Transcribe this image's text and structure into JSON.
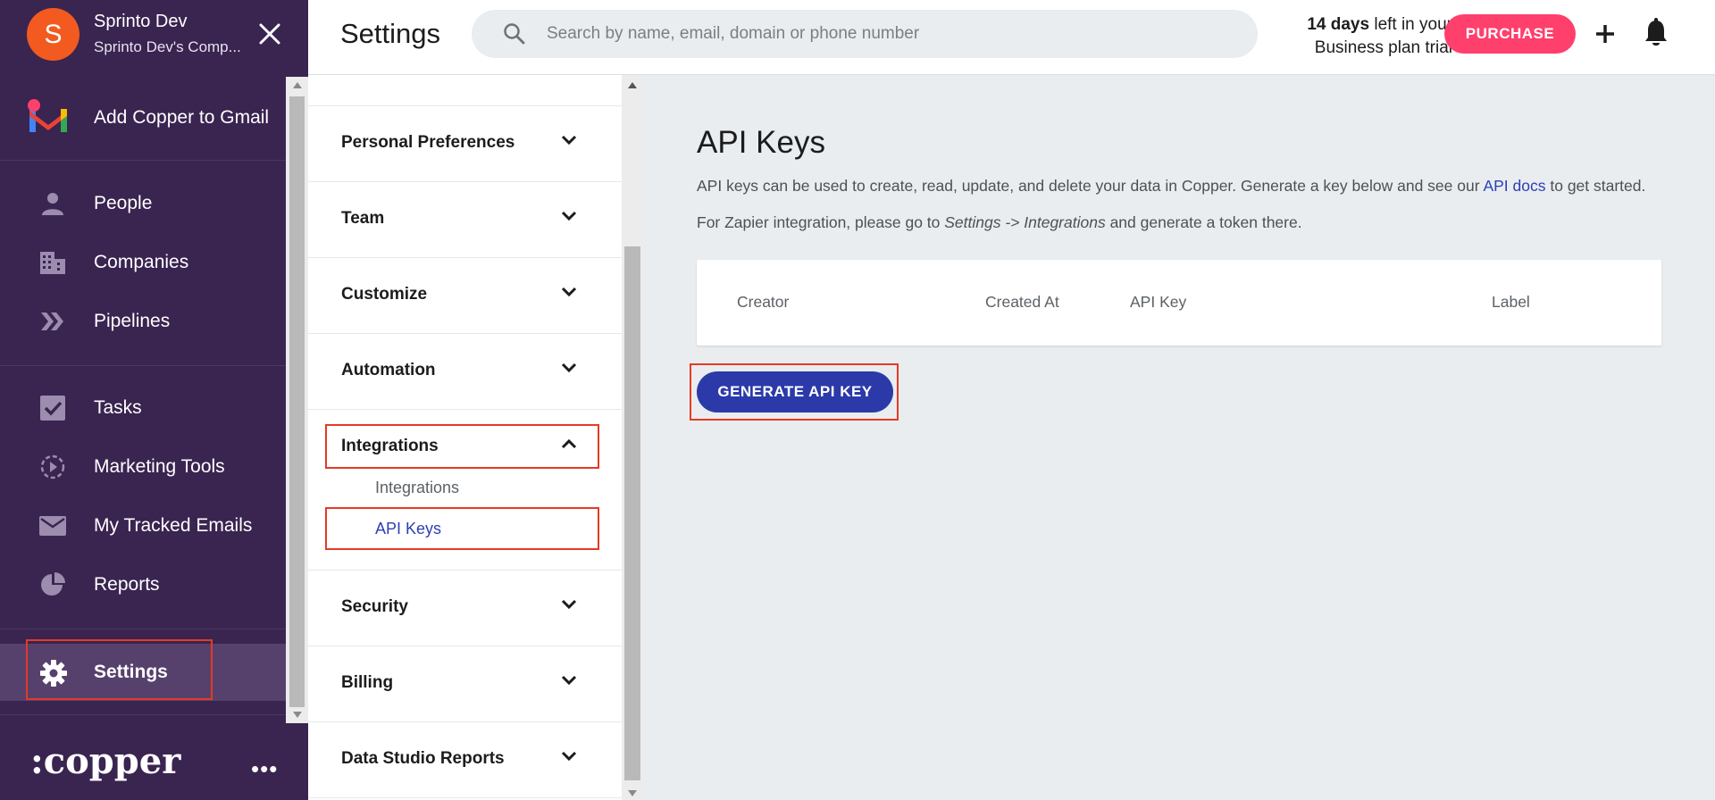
{
  "sidebar": {
    "user": {
      "initial": "S",
      "name": "Sprinto Dev",
      "company": "Sprinto Dev's Comp..."
    },
    "gmail_label": "Add Copper to Gmail",
    "nav_primary": [
      {
        "label": "People",
        "icon": "person-icon"
      },
      {
        "label": "Companies",
        "icon": "building-icon"
      },
      {
        "label": "Pipelines",
        "icon": "chevrons-right-icon"
      }
    ],
    "nav_secondary": [
      {
        "label": "Tasks",
        "icon": "checkbox-icon"
      },
      {
        "label": "Marketing Tools",
        "icon": "marketing-play-icon"
      },
      {
        "label": "My Tracked Emails",
        "icon": "envelope-icon"
      },
      {
        "label": "Reports",
        "icon": "pie-chart-icon"
      }
    ],
    "settings_label": "Settings",
    "brand": ":copper",
    "more": "•••",
    "colors": {
      "bg": "#3a2450",
      "active": "#56416c",
      "avatar": "#f25a1f"
    }
  },
  "topbar": {
    "title": "Settings",
    "search_placeholder": "Search by name, email, domain or phone number",
    "trial_days": "14 days",
    "trial_rest": " left in your",
    "trial_line2": "Business plan trial",
    "purchase": "PURCHASE",
    "colors": {
      "purchase": "#ff3f6c"
    }
  },
  "settings_menu": {
    "items": [
      {
        "label": "Personal Preferences",
        "expanded": false
      },
      {
        "label": "Team",
        "expanded": false
      },
      {
        "label": "Customize",
        "expanded": false
      },
      {
        "label": "Automation",
        "expanded": false
      },
      {
        "label": "Integrations",
        "expanded": true
      },
      {
        "label": "Security",
        "expanded": false
      },
      {
        "label": "Billing",
        "expanded": false
      },
      {
        "label": "Data Studio Reports",
        "expanded": false
      }
    ],
    "integrations_sub": [
      {
        "label": "Integrations",
        "active": false
      },
      {
        "label": "API Keys",
        "active": true
      }
    ]
  },
  "main": {
    "heading": "API Keys",
    "description_pre": "API keys can be used to create, read, update, and delete your data in Copper. Generate a key below and see our ",
    "description_link": "API docs",
    "description_post": " to get started.",
    "zapier_pre": "For Zapier integration, please go to ",
    "zapier_path": "Settings -> Integrations",
    "zapier_post": " and generate a token there.",
    "table_headers": [
      "Creator",
      "Created At",
      "API Key",
      "Label"
    ],
    "generate_button": "GENERATE API KEY",
    "colors": {
      "primary": "#2b3aa8",
      "highlight": "#e53a24"
    }
  }
}
